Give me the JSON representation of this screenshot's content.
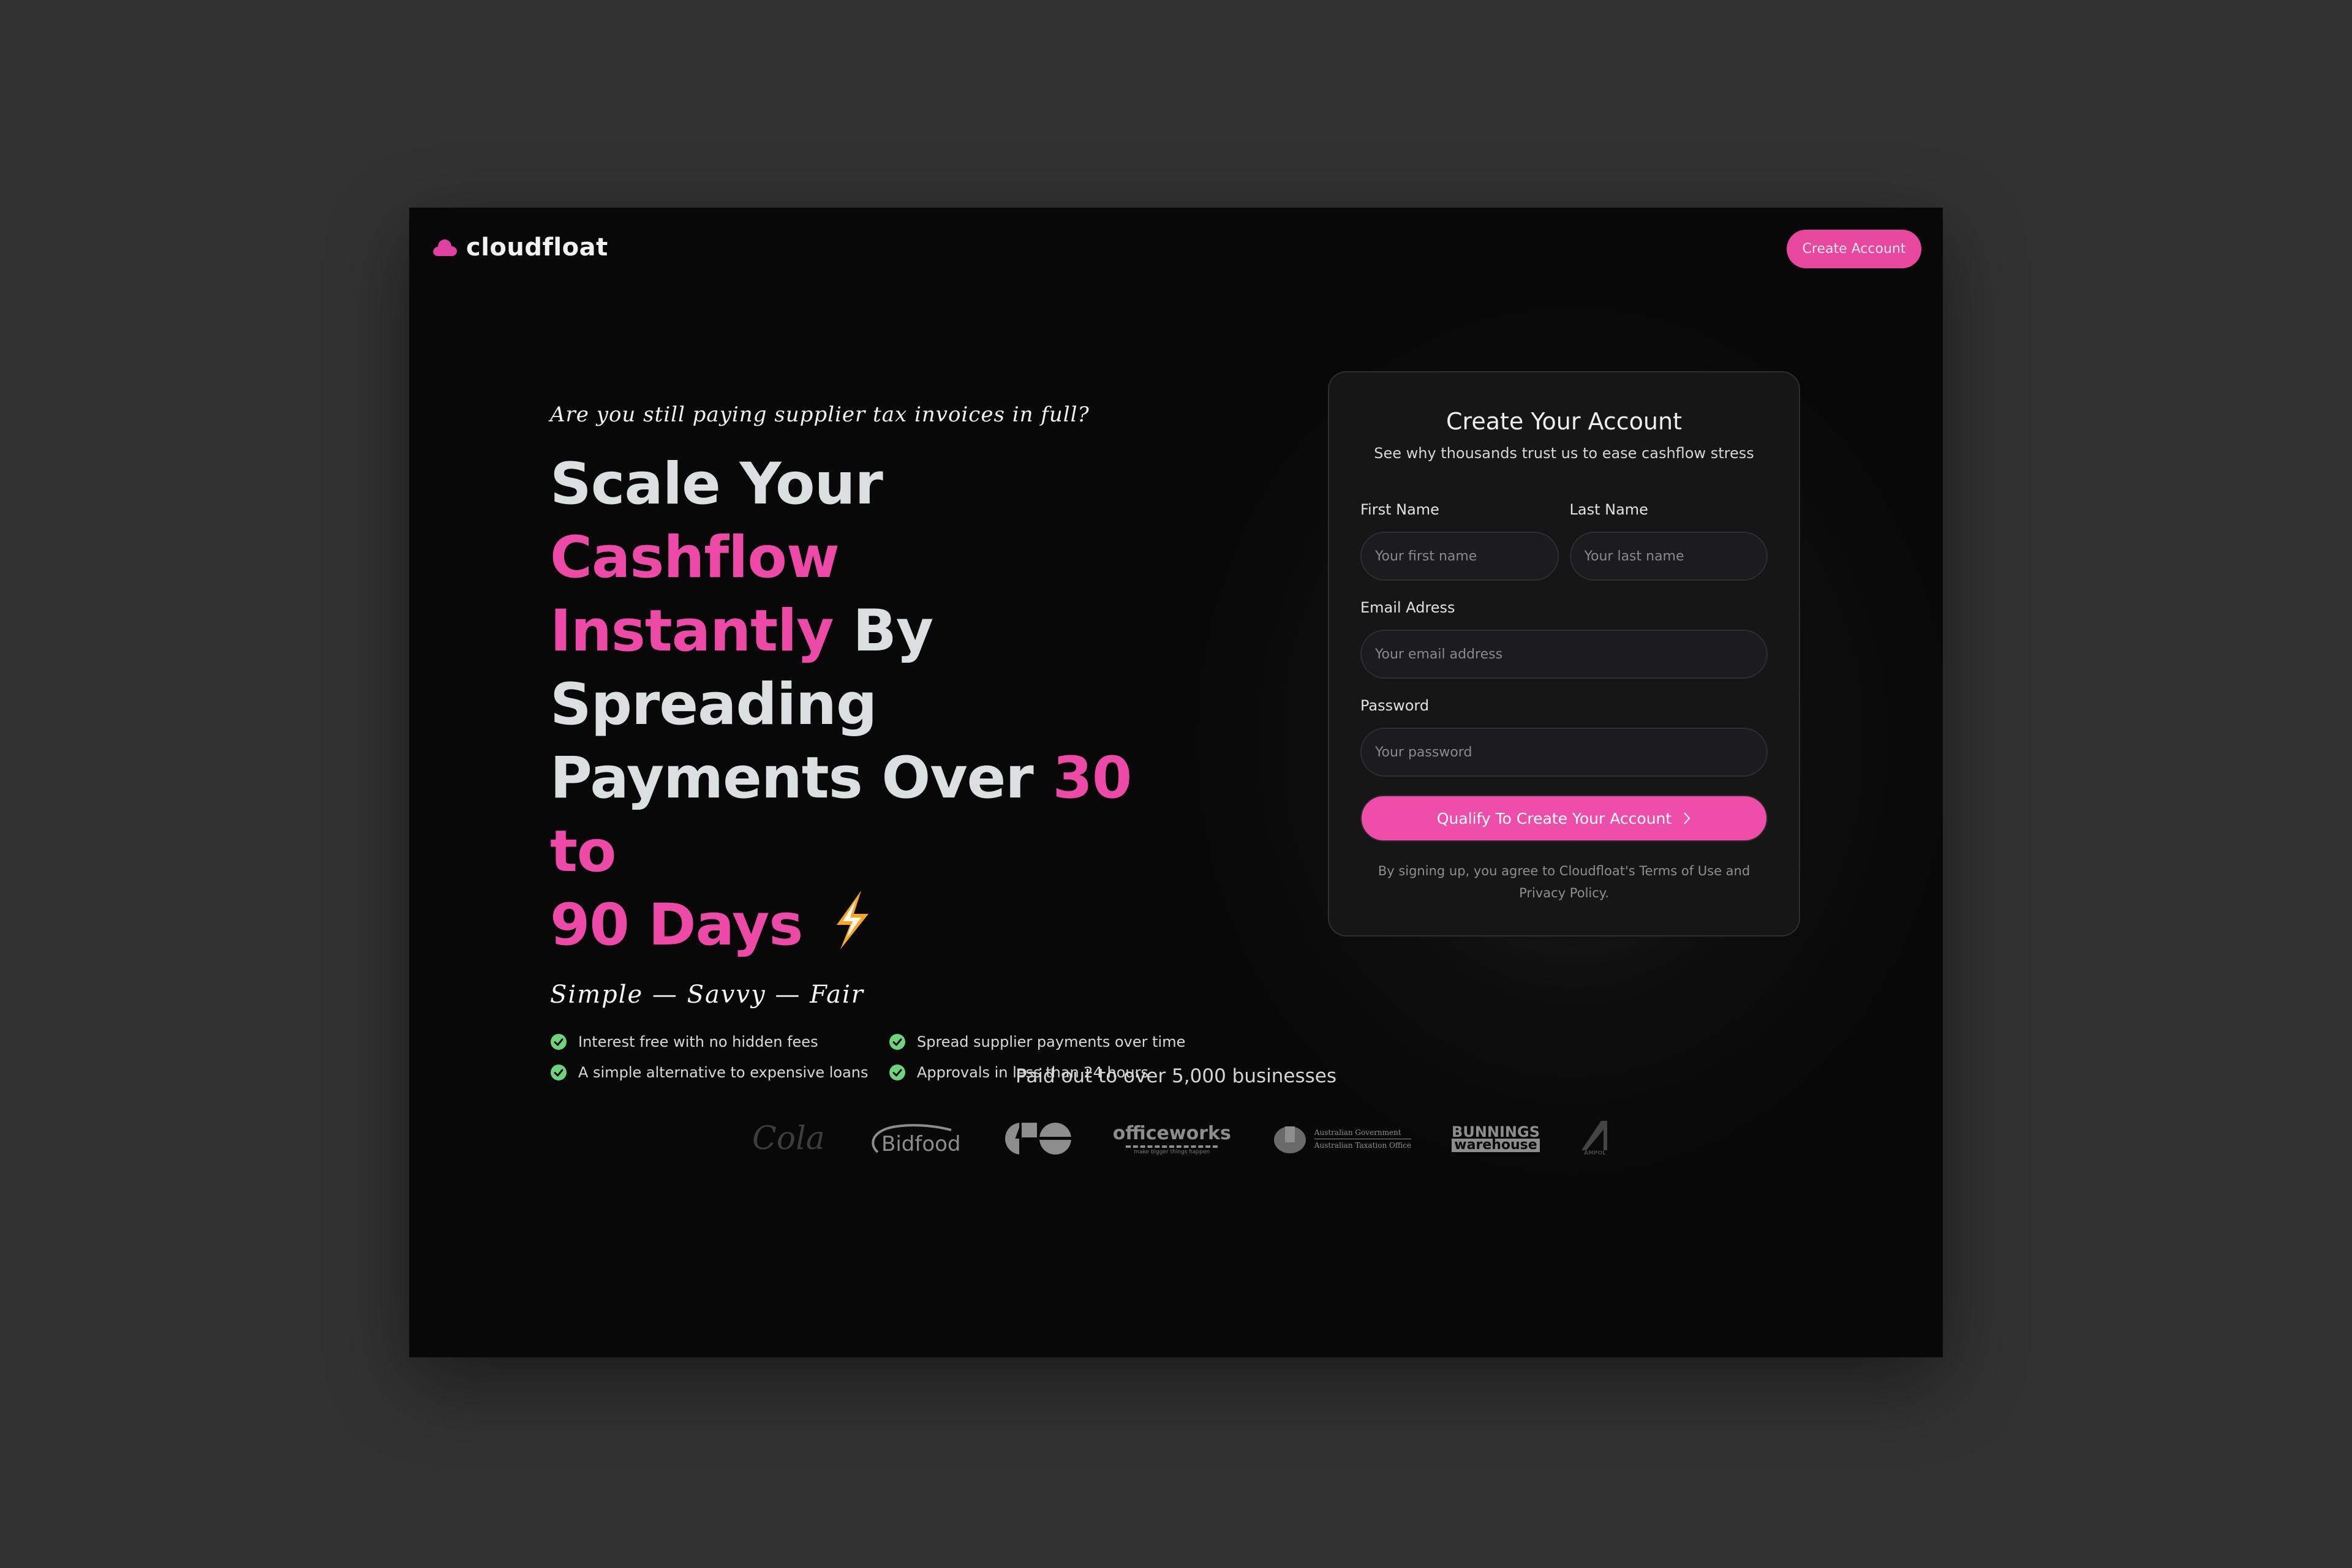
{
  "brand": {
    "name": "cloudfloat",
    "icon": "cloud-icon",
    "accent_color": "#ec4aa6"
  },
  "nav": {
    "create_account_label": "Create Account"
  },
  "hero": {
    "tagline": "Are you still paying supplier tax invoices in full?",
    "headline": [
      {
        "text": "Scale Your ",
        "highlight": false
      },
      {
        "text": "Cashflow",
        "highlight": true
      },
      {
        "text": "Instantly",
        "highlight": true
      },
      {
        "text": " By Spreading",
        "highlight": false
      },
      {
        "text": "Payments Over ",
        "highlight": false
      },
      {
        "text": "30 to",
        "highlight": true
      },
      {
        "text": "90 Days",
        "highlight": true
      }
    ],
    "headline_icon": "lightning-bolt-icon",
    "motto": "Simple — Savvy — Fair",
    "features": [
      "Interest free with no hidden fees",
      "Spread supplier payments over time",
      "A simple alternative to expensive loans",
      "Approvals in less than 24 hours"
    ],
    "feature_icon": "check-circle-icon",
    "feature_icon_color": "#6fd37d"
  },
  "form": {
    "title": "Create Your Account",
    "subtitle": "See why thousands trust us to ease cashflow stress",
    "first_name": {
      "label": "First Name",
      "placeholder": "Your first name",
      "value": ""
    },
    "last_name": {
      "label": "Last Name",
      "placeholder": "Your last name",
      "value": ""
    },
    "email": {
      "label": "Email Adress",
      "placeholder": "Your email address",
      "value": ""
    },
    "password": {
      "label": "Password",
      "placeholder": "Your password",
      "value": ""
    },
    "submit_label": "Qualify To Create Your Account",
    "submit_icon": "chevron-right-icon",
    "terms": "By signing up, you agree to Cloudfloat's Terms of Use and Privacy Policy."
  },
  "trust": {
    "text": "Paid out to over 5,000 businesses",
    "logos": [
      "Coca-Cola",
      "Bidfood",
      "GO",
      "officeworks",
      "Australian Government Australian Taxation Office",
      "Bunnings Warehouse",
      "Ampol"
    ],
    "officeworks_tagline": "make bigger things happen",
    "ato_line1": "Australian Government",
    "ato_line2": "Australian Taxation Office",
    "bunnings_line1": "BUNNINGS",
    "bunnings_line2": "warehouse",
    "ampol_text": "AMPOL"
  }
}
